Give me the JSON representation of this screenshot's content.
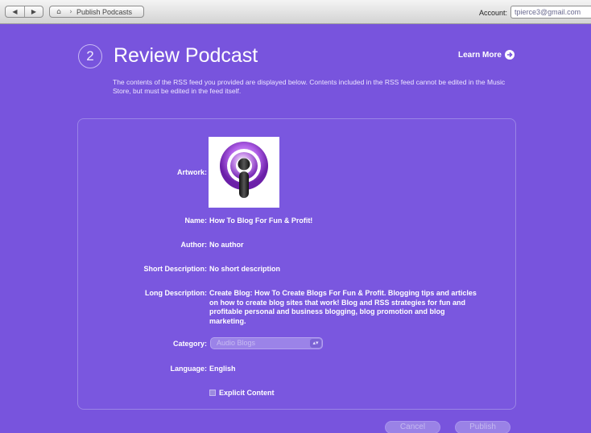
{
  "toolbar": {
    "back_icon": "back-arrow-icon",
    "forward_icon": "forward-arrow-icon",
    "home_icon": "home-icon",
    "breadcrumb": "Publish Podcasts",
    "account_label": "Account:",
    "account_value": "tpierce3@gmail.com"
  },
  "page": {
    "step_number": "2",
    "title": "Review Podcast",
    "learn_more": "Learn More",
    "intro": "The contents of the RSS feed you provided are displayed below. Contents included in the RSS feed cannot be edited in the Music Store, but must be edited in the feed itself."
  },
  "form": {
    "artwork_label": "Artwork:",
    "name_label": "Name:",
    "name_value": "How To Blog For Fun & Profit!",
    "author_label": "Author:",
    "author_value": "No author",
    "short_label": "Short Description:",
    "short_value": "No short description",
    "long_label": "Long Description:",
    "long_value": "Create Blog: How To Create Blogs For Fun & Profit. Blogging tips and articles on how to create blog sites that work! Blog and RSS strategies for fun and profitable personal and business blogging, blog promotion and blog marketing.",
    "category_label": "Category:",
    "category_value": "Audio Blogs",
    "language_label": "Language:",
    "language_value": "English",
    "explicit_label": "Explicit Content"
  },
  "buttons": {
    "cancel": "Cancel",
    "publish": "Publish"
  },
  "colors": {
    "background": "#7854dd",
    "panel_border": "#9a84e6",
    "disabled_button": "#9a82e6"
  }
}
